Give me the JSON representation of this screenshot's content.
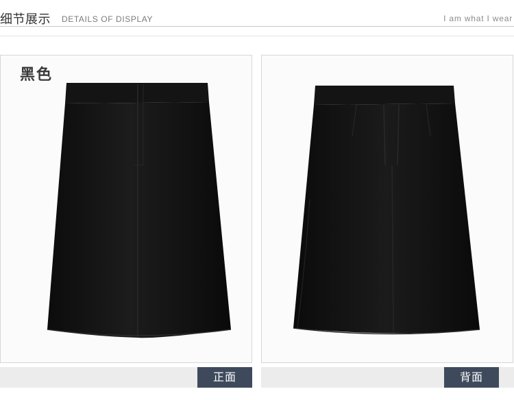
{
  "header": {
    "title_cn": "细节展示",
    "title_en": "DETAILS OF DISPLAY",
    "tagline": "I am what I wear"
  },
  "left_panel": {
    "color_label": "黑色",
    "caption": "正面",
    "image": "black-skirt-front"
  },
  "right_panel": {
    "caption": "背面",
    "image": "black-skirt-back"
  },
  "colors": {
    "tag_bg": "#3e4a5c",
    "skirt": "#111111",
    "footer_bar": "#ececec"
  }
}
